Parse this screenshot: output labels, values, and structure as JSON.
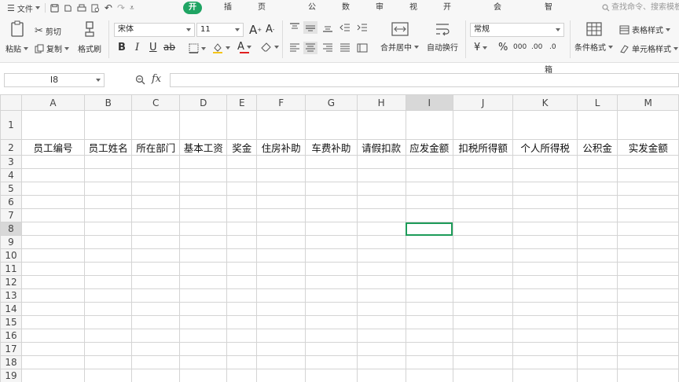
{
  "menubar": {
    "file_label": "文件",
    "tabs": [
      {
        "label": "开始",
        "active": true
      },
      {
        "label": "插入",
        "active": false
      },
      {
        "label": "页面布局",
        "active": false
      },
      {
        "label": "公式",
        "active": false
      },
      {
        "label": "数据",
        "active": false
      },
      {
        "label": "审阅",
        "active": false
      },
      {
        "label": "视图",
        "active": false
      },
      {
        "label": "开发工具",
        "active": false
      },
      {
        "label": "会员专享",
        "active": false
      },
      {
        "label": "智能工具箱",
        "active": false
      }
    ],
    "search_placeholder": "查找命令、搜索模板",
    "accent_color": "#1fa463"
  },
  "ribbon": {
    "paste_label": "粘贴",
    "cut_label": "剪切",
    "copy_label": "复制",
    "format_painter_label": "格式刷",
    "font_name": "宋体",
    "font_size": "11",
    "merge_center_label": "合并居中",
    "wrap_text_label": "自动换行",
    "number_format": "常规",
    "table_style_label": "表格样式",
    "cond_format_label": "条件格式",
    "cell_style_label": "单元格样式",
    "currency_symbol": "¥",
    "percent_symbol": "%",
    "thousands_symbol": "000",
    "inc_decimal": ".00",
    "dec_decimal": ".0"
  },
  "formula_bar": {
    "name_box": "I8",
    "fx_label": "fx",
    "formula": ""
  },
  "sheet": {
    "columns": [
      "A",
      "B",
      "C",
      "D",
      "E",
      "F",
      "G",
      "H",
      "I",
      "J",
      "K",
      "L",
      "M"
    ],
    "selected_column": "I",
    "rows": [
      "1",
      "2",
      "3",
      "4",
      "5",
      "6",
      "7",
      "8",
      "9",
      "10",
      "11",
      "12",
      "13",
      "14",
      "15",
      "16",
      "17",
      "18",
      "19"
    ],
    "selected_row": "8",
    "active_cell": "I8",
    "header_row": [
      "员工编号",
      "员工姓名",
      "所在部门",
      "基本工资",
      "奖金",
      "住房补助",
      "车费补助",
      "请假扣款",
      "应发金额",
      "扣税所得额",
      "个人所得税",
      "公积金",
      "实发金额"
    ]
  }
}
